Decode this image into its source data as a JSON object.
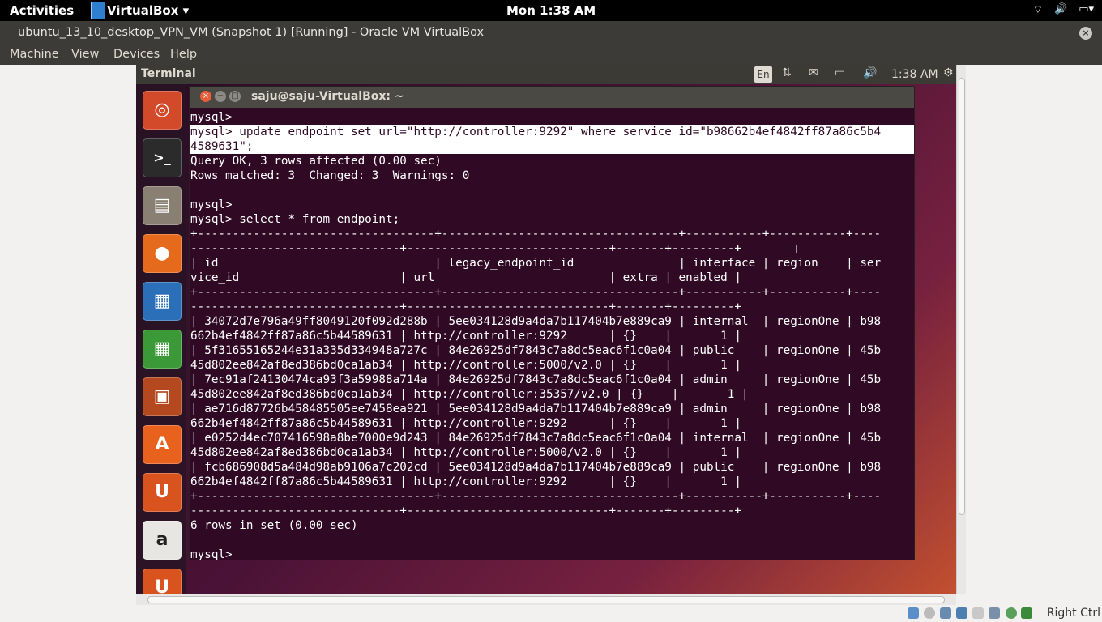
{
  "top_bar": {
    "activities": "Activities",
    "app_name": "VirtualBox ▾",
    "clock": "Mon  1:38 AM",
    "tray_icons": [
      "wifi-icon",
      "volume-icon",
      "battery-icon"
    ]
  },
  "window": {
    "title": "ubuntu_13_10_desktop_VPN_VM (Snapshot 1) [Running] - Oracle VM VirtualBox"
  },
  "menu": {
    "machine": "Machine",
    "view": "View",
    "devices": "Devices",
    "help": "Help"
  },
  "guest_panel": {
    "app_title": "Terminal",
    "keyboard": "En",
    "time": "1:38 AM"
  },
  "launcher": {
    "items": [
      "ubuntu-dash",
      "terminal",
      "files",
      "firefox",
      "libreoffice-writer",
      "libreoffice-calc",
      "libreoffice-impress",
      "software-center",
      "ubuntu-one",
      "amazon",
      "ubuntu-one-music"
    ]
  },
  "terminal": {
    "title": "saju@saju-VirtualBox: ~",
    "lines": [
      "mysql>",
      "mysql> update endpoint set url=\"http://controller:9292\" where service_id=\"b98662b4ef4842ff87a86c5b4",
      "4589631\";",
      "Query OK, 3 rows affected (0.00 sec)",
      "Rows matched: 3  Changed: 3  Warnings: 0",
      "",
      "mysql>",
      "mysql> select * from endpoint;",
      "+----------------------------------+----------------------------------+-----------+-----------+----",
      "------------------------------+-----------------------------+-------+---------+",
      "| id                               | legacy_endpoint_id               | interface | region    | ser",
      "vice_id                       | url                         | extra | enabled |",
      "+----------------------------------+----------------------------------+-----------+-----------+----",
      "------------------------------+-----------------------------+-------+---------+",
      "| 34072d7e796a49ff8049120f092d288b | 5ee034128d9a4da7b117404b7e889ca9 | internal  | regionOne | b98",
      "662b4ef4842ff87a86c5b44589631 | http://controller:9292      | {}    |       1 |",
      "| 5f31655165244e31a335d334948a727c | 84e26925df7843c7a8dc5eac6f1c0a04 | public    | regionOne | 45b",
      "45d802ee842af8ed386bd0ca1ab34 | http://controller:5000/v2.0 | {}    |       1 |",
      "| 7ec91af24130474ca93f3a59988a714a | 84e26925df7843c7a8dc5eac6f1c0a04 | admin     | regionOne | 45b",
      "45d802ee842af8ed386bd0ca1ab34 | http://controller:35357/v2.0 | {}    |       1 |",
      "| ae716d87726b458485505ee7458ea921 | 5ee034128d9a4da7b117404b7e889ca9 | admin     | regionOne | b98",
      "662b4ef4842ff87a86c5b44589631 | http://controller:9292      | {}    |       1 |",
      "| e0252d4ec707416598a8be7000e9d243 | 84e26925df7843c7a8dc5eac6f1c0a04 | internal  | regionOne | 45b",
      "45d802ee842af8ed386bd0ca1ab34 | http://controller:5000/v2.0 | {}    |       1 |",
      "| fcb686908d5a484d98ab9106a7c202cd | 5ee034128d9a4da7b117404b7e889ca9 | public    | regionOne | b98",
      "662b4ef4842ff87a86c5b44589631 | http://controller:9292      | {}    |       1 |",
      "+----------------------------------+----------------------------------+-----------+-----------+----",
      "------------------------------+-----------------------------+-------+---------+",
      "6 rows in set (0.00 sec)",
      "",
      "mysql>"
    ]
  },
  "status_bar": {
    "host_key": "Right Ctrl"
  }
}
